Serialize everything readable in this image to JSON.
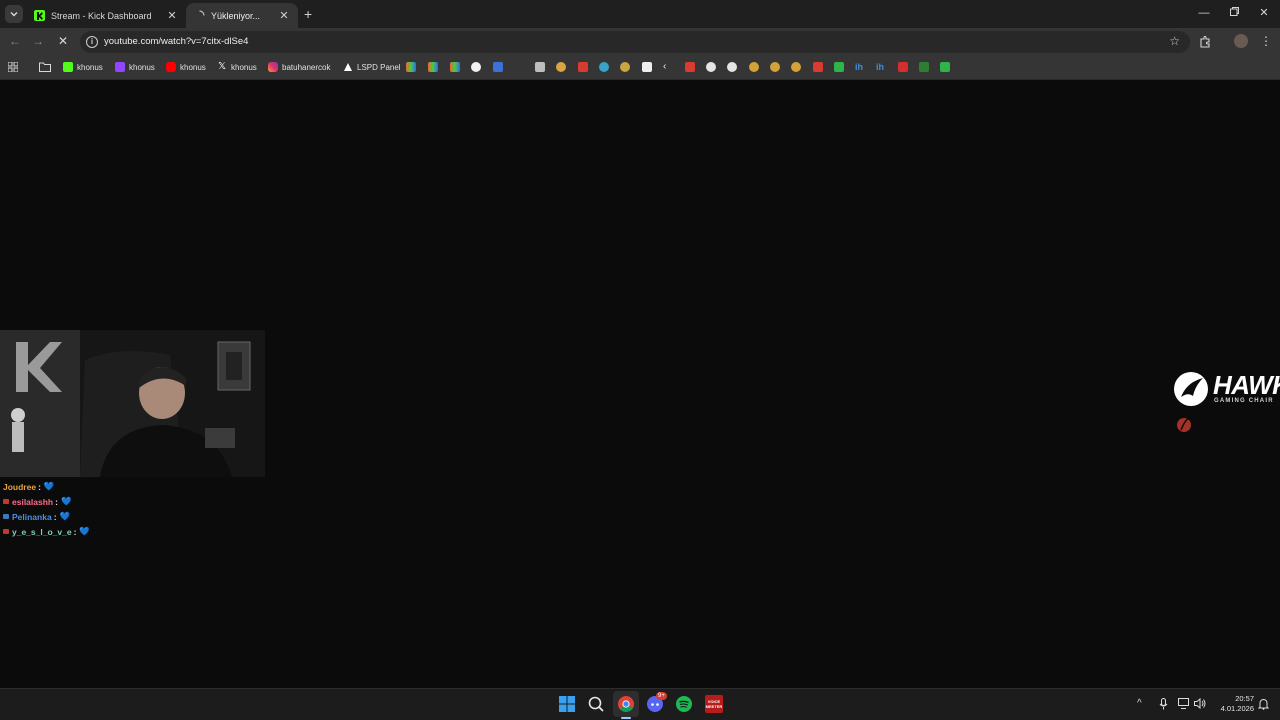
{
  "browser": {
    "tabs": [
      {
        "title": "Stream - Kick Dashboard",
        "active": false
      },
      {
        "title": "Yükleniyor...",
        "active": true
      }
    ],
    "address": {
      "url": "youtube.com/watch?v=7citx-dlSe4"
    },
    "bookmarks": [
      {
        "label": "khonus",
        "icon": "kick-icon",
        "color": "#53fc18"
      },
      {
        "label": "khonus",
        "icon": "twitch-icon",
        "color": "#9146ff"
      },
      {
        "label": "khonus",
        "icon": "youtube-icon",
        "color": "#ff0000"
      },
      {
        "label": "khonus",
        "icon": "x-icon",
        "color": "#ffffff"
      },
      {
        "label": "batuhanercok",
        "icon": "instagram-icon",
        "color": "#e1306c"
      },
      {
        "label": "LSPD Panel",
        "icon": "lspd-icon",
        "color": "#ffffff"
      }
    ]
  },
  "stream": {
    "chat": [
      {
        "user": "Joudree",
        "sep": ":",
        "emote": "💙",
        "color": "#e8a33d",
        "badge": "none"
      },
      {
        "user": "esilalashh",
        "sep": ":",
        "emote": "💙",
        "color": "#ff6b8b",
        "badge": "#c0392b"
      },
      {
        "user": "Pelinanka",
        "sep": ":",
        "emote": "💙",
        "color": "#4a90e2",
        "badge": "#3a78c2"
      },
      {
        "user": "y_e_s_l_o_v_e",
        "sep": ":",
        "emote": "💙",
        "color": "#7fd4b8",
        "badge": "#c0392b"
      }
    ],
    "sponsor": {
      "name": "HAWK",
      "tagline": "GAMING CHAIR"
    }
  },
  "taskbar": {
    "time": "20:57",
    "date": "4.01.2026",
    "discord_badge": "9+",
    "app_label": "VOICE MEETER"
  }
}
